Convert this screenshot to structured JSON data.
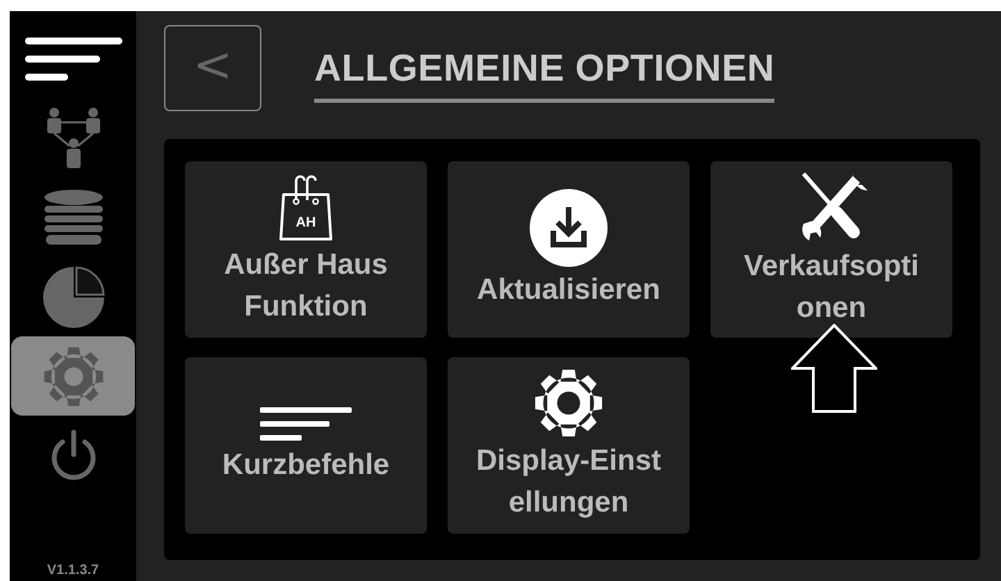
{
  "sidebar": {
    "items": [
      {
        "kind": "menu",
        "selected": false
      },
      {
        "kind": "network",
        "selected": false
      },
      {
        "kind": "database",
        "selected": false
      },
      {
        "kind": "pie",
        "selected": false
      },
      {
        "kind": "gear",
        "selected": true
      },
      {
        "kind": "power",
        "selected": false
      }
    ],
    "version": "V1.1.3.7"
  },
  "header": {
    "back_symbol": "<",
    "title": "ALLGEMEINE OPTIONEN"
  },
  "tiles": [
    {
      "kind": "bag",
      "icon_text": "AH",
      "lines": [
        "Außer Haus",
        "Funktion"
      ]
    },
    {
      "kind": "download",
      "lines": [
        "Aktualisieren"
      ]
    },
    {
      "kind": "tools",
      "lines": [
        "Verkaufsopti",
        "onen"
      ],
      "pointer": true
    },
    {
      "kind": "lines",
      "lines": [
        "Kurzbefehle"
      ]
    },
    {
      "kind": "gear",
      "lines": [
        "Display-Einst",
        "ellungen"
      ]
    }
  ]
}
